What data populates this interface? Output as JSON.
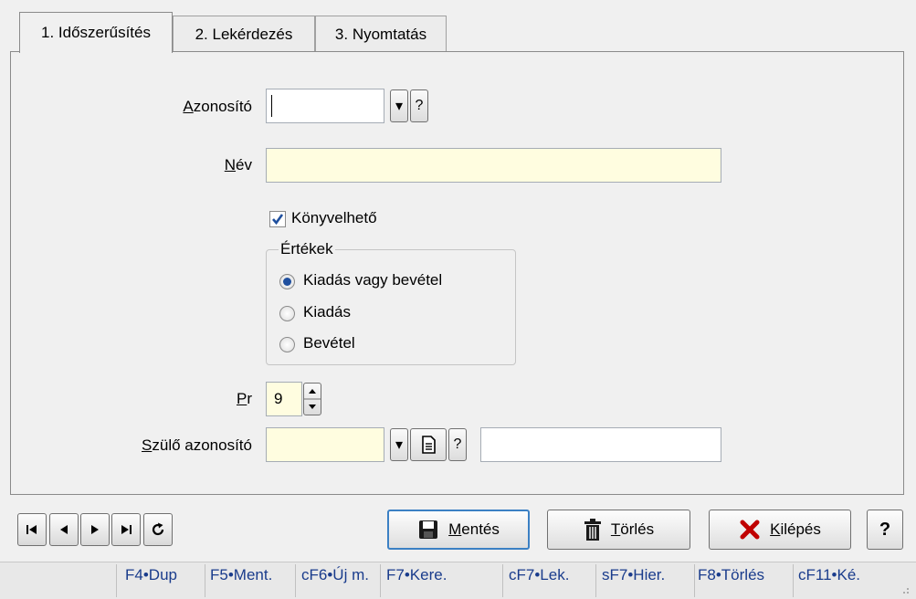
{
  "tabs": [
    {
      "label": "1. Időszerűsítés",
      "active": true
    },
    {
      "label": "2. Lekérdezés",
      "active": false
    },
    {
      "label": "3. Nyomtatás",
      "active": false
    }
  ],
  "form": {
    "azonosito_label_first": "A",
    "azonosito_label_rest": "zonosító",
    "azonosito_value": "",
    "dropdown_glyph": "▾",
    "help_glyph": "?",
    "nev_label_first": "N",
    "nev_label_rest": "év",
    "nev_value": "",
    "konyvelheto_label": "Könyvelhető",
    "konyvelheto_checked": true,
    "ertekek_title": "Értékek",
    "radios": [
      {
        "label": "Kiadás vagy bevétel",
        "checked": true
      },
      {
        "label": "Kiadás",
        "checked": false
      },
      {
        "label": "Bevétel",
        "checked": false
      }
    ],
    "pr_label_first": "P",
    "pr_label_rest": "r",
    "pr_value": "9",
    "szulo_label_first": "S",
    "szulo_label_rest": "zülő azonosító",
    "szulo_value": "",
    "szulo_name_value": ""
  },
  "buttons": {
    "save_first": "M",
    "save_rest": "entés",
    "delete_first": "T",
    "delete_rest": "örlés",
    "exit_first": "K",
    "exit_rest": "ilépés",
    "help": "?"
  },
  "function_keys": [
    "F4•Dup",
    "F5•Ment.",
    "cF6•Új m.",
    "F7•Kere.",
    "cF7•Lek.",
    "sF7•Hier.",
    "F8•Törlés",
    "cF11•Ké."
  ],
  "colors": {
    "accent": "#1f4f9e",
    "required_field": "#fffde0",
    "delete_icon": "#c00000"
  }
}
